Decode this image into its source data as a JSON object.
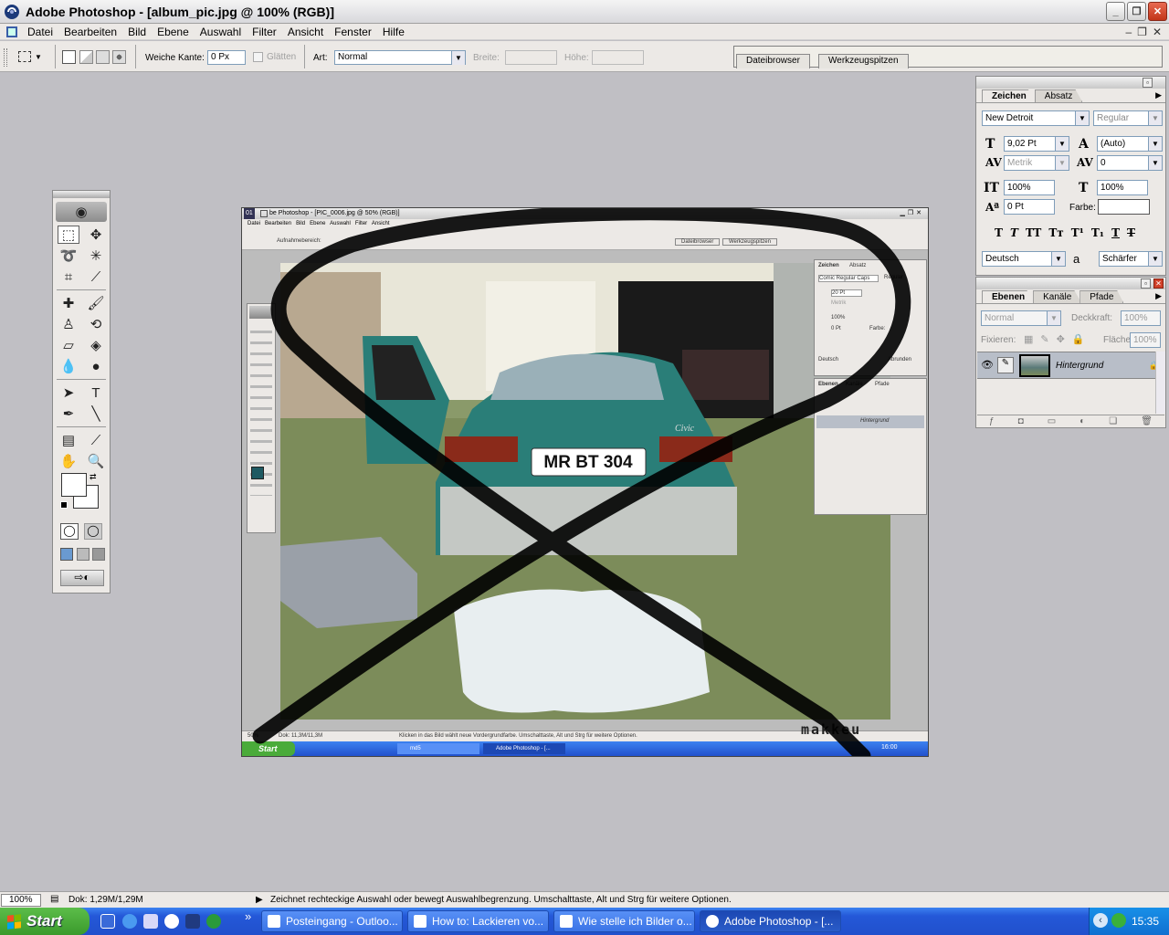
{
  "app": {
    "title": "Adobe Photoshop - [album_pic.jpg @ 100% (RGB)]",
    "menu": [
      "Datei",
      "Bearbeiten",
      "Bild",
      "Ebene",
      "Auswahl",
      "Filter",
      "Ansicht",
      "Fenster",
      "Hilfe"
    ]
  },
  "options": {
    "feather_label": "Weiche Kante:",
    "feather_value": "0 Px",
    "antialias_label": "Glätten",
    "style_label": "Art:",
    "style_value": "Normal",
    "width_label": "Breite:",
    "height_label": "Höhe:",
    "well_tabs": [
      "Dateibrowser",
      "Werkzeugspitzen"
    ]
  },
  "character_panel": {
    "tabs": [
      "Zeichen",
      "Absatz"
    ],
    "font_family": "New Detroit",
    "font_style": "Regular",
    "font_size": "9,02 Pt",
    "leading": "(Auto)",
    "kerning": "Metrik",
    "tracking": "0",
    "vertical_scale": "100%",
    "horizontal_scale": "100%",
    "baseline_shift": "0 Pt",
    "color_label": "Farbe:",
    "language": "Deutsch",
    "antialias_label": "a",
    "antialias": "Schärfer"
  },
  "layers_panel": {
    "tabs": [
      "Ebenen",
      "Kanäle",
      "Pfade"
    ],
    "blend_mode": "Normal",
    "opacity_label": "Deckkraft:",
    "opacity": "100%",
    "lock_label": "Fixieren:",
    "fill_label": "Fläche:",
    "fill": "100%",
    "layer_name": "Hintergrund"
  },
  "document": {
    "title": "be Photoshop - [PIC_0006.jpg @ 50% (RGB)]",
    "number": "01",
    "inner_menu": [
      "Datei",
      "Bearbeiten",
      "Bild",
      "Ebene",
      "Auswahl",
      "Filter",
      "Ansicht"
    ],
    "inner_option": "Aufnahmebereich:",
    "inner_tabs": [
      "Dateibrowser",
      "Werkzeugspitzen"
    ],
    "inner_panel_tabs": [
      "Zeichen",
      "Absatz"
    ],
    "inner_font": "Comic Regular Caps",
    "inner_style": "Regular",
    "inner_size": "20 Pt",
    "inner_kerning": "Metrik",
    "inner_scale": "100%",
    "inner_shift": "0 Pt",
    "inner_color": "Farbe:",
    "inner_lang": "Deutsch",
    "inner_aa": "Abrunden",
    "inner_layer_tabs": [
      "Ebenen",
      "Kanäle",
      "Pfade"
    ],
    "inner_layer": "Hintergrund",
    "inner_status": "Dok: 11,3M/11,3M",
    "inner_hint": "Klicken in das Bild wählt neue Vordergrundfarbe. Umschalttaste, Alt und Strg für weitere Optionen.",
    "inner_zoom": "50%",
    "inner_taskbar": [
      "Start",
      "md5",
      "Adobe Photoshop - [..."
    ],
    "inner_clock": "16:00",
    "plate": "MR BT 304",
    "car_badge": "Civic",
    "watermark": "makkeu"
  },
  "status": {
    "zoom": "100%",
    "doc": "Dok: 1,29M/1,29M",
    "hint": "Zeichnet rechteckige Auswahl oder bewegt Auswahlbegrenzung. Umschalttaste, Alt und Strg für weitere Optionen."
  },
  "taskbar": {
    "start": "Start",
    "more": "»",
    "tasks": [
      "Posteingang - Outloo...",
      "How to: Lackieren vo...",
      "Wie stelle ich Bilder o...",
      "Adobe Photoshop - [..."
    ],
    "clock": "15:35"
  }
}
